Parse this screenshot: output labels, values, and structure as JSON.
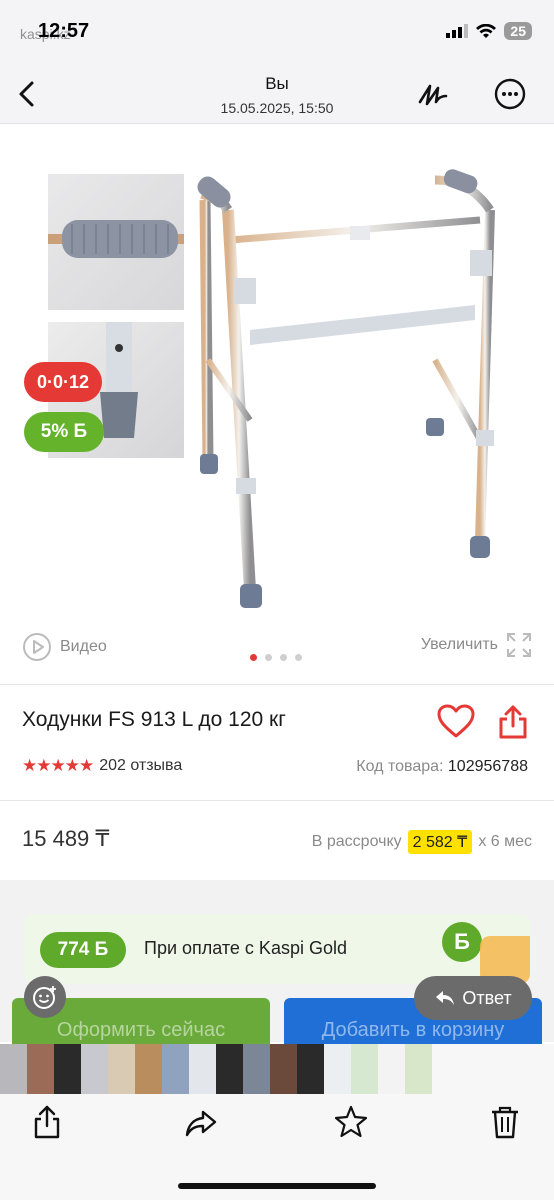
{
  "status": {
    "time": "12:57",
    "app_ghost": "kaspi.kz",
    "battery": "25"
  },
  "header": {
    "title": "Вы",
    "subtitle": "15.05.2025, 15:50"
  },
  "gallery": {
    "badge_installment": "0·0·12",
    "badge_bonus": "5% Б",
    "video_label": "Видео",
    "zoom_label": "Увеличить",
    "dots_total": 4,
    "dot_active": 1
  },
  "product": {
    "title": "Ходунки FS 913 L до 120 кг",
    "stars": "★★★★★",
    "reviews": "202 отзыва",
    "code_label": "Код товара:",
    "code_value": "102956788",
    "price": "15 489 ₸",
    "installment_label": "В рассрочку",
    "installment_value": "2 582 ₸",
    "installment_term": "x 6 мес"
  },
  "kaspi_gold": {
    "bonus": "774 Б",
    "text": "При оплате с Kaspi Gold",
    "logo": "Б"
  },
  "buttons": {
    "checkout": "Оформить сейчас",
    "add_to_cart": "Добавить в корзину",
    "reply": "Ответ"
  },
  "colors": {
    "accent_red": "#e53935",
    "kaspi_green": "#64b32a",
    "yellow": "#ffe100",
    "blue": "#1f6fd6"
  },
  "icons": [
    "back-icon",
    "draw-icon",
    "more-icon",
    "play-icon",
    "expand-icon",
    "heart-icon",
    "share-icon",
    "emoji-icon",
    "reply-icon",
    "share-out-icon",
    "forward-icon",
    "star-icon",
    "trash-icon"
  ]
}
